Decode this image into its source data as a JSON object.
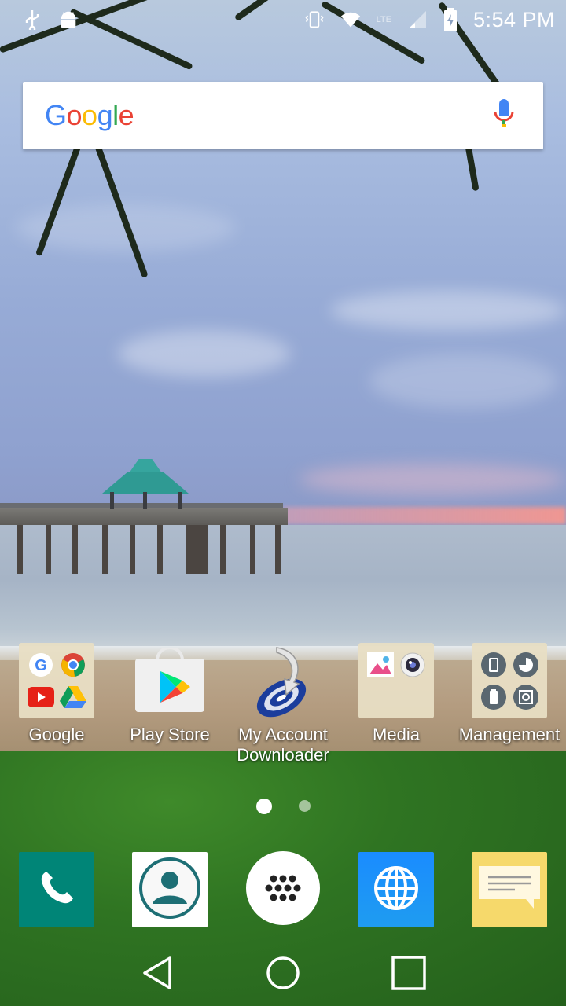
{
  "status_bar": {
    "time": "5:54 PM",
    "icons": [
      "usb-icon",
      "android-debug-icon",
      "vibrate-icon",
      "wifi-icon",
      "lte-icon",
      "signal-icon",
      "battery-charging-icon"
    ],
    "lte_label": "LTE"
  },
  "search": {
    "logo_letters": [
      {
        "ch": "G",
        "color": "#4285F4"
      },
      {
        "ch": "o",
        "color": "#EA4335"
      },
      {
        "ch": "o",
        "color": "#FBBC05"
      },
      {
        "ch": "g",
        "color": "#4285F4"
      },
      {
        "ch": "l",
        "color": "#34A853"
      },
      {
        "ch": "e",
        "color": "#EA4335"
      }
    ],
    "mic_icon": "mic-icon"
  },
  "apps": [
    {
      "label": "Google",
      "icon": "google-folder-icon"
    },
    {
      "label": "Play Store",
      "icon": "play-store-icon"
    },
    {
      "label": "My Account\nDownloader",
      "label_line1": "My Account",
      "label_line2": "Downloader",
      "icon": "my-account-downloader-icon"
    },
    {
      "label": "Media",
      "icon": "media-folder-icon"
    },
    {
      "label": "Management",
      "icon": "management-folder-icon"
    }
  ],
  "pager": {
    "pages": 2,
    "active_index": 0
  },
  "dock": [
    {
      "icon": "phone-icon",
      "color": "#008577"
    },
    {
      "icon": "contacts-icon",
      "color": "#ffffff"
    },
    {
      "icon": "app-drawer-icon",
      "color": "#ffffff"
    },
    {
      "icon": "browser-icon",
      "color": "#1a8cff"
    },
    {
      "icon": "messages-icon",
      "color": "#f6d96b"
    }
  ],
  "nav": [
    "back-icon",
    "home-icon",
    "recents-icon"
  ]
}
